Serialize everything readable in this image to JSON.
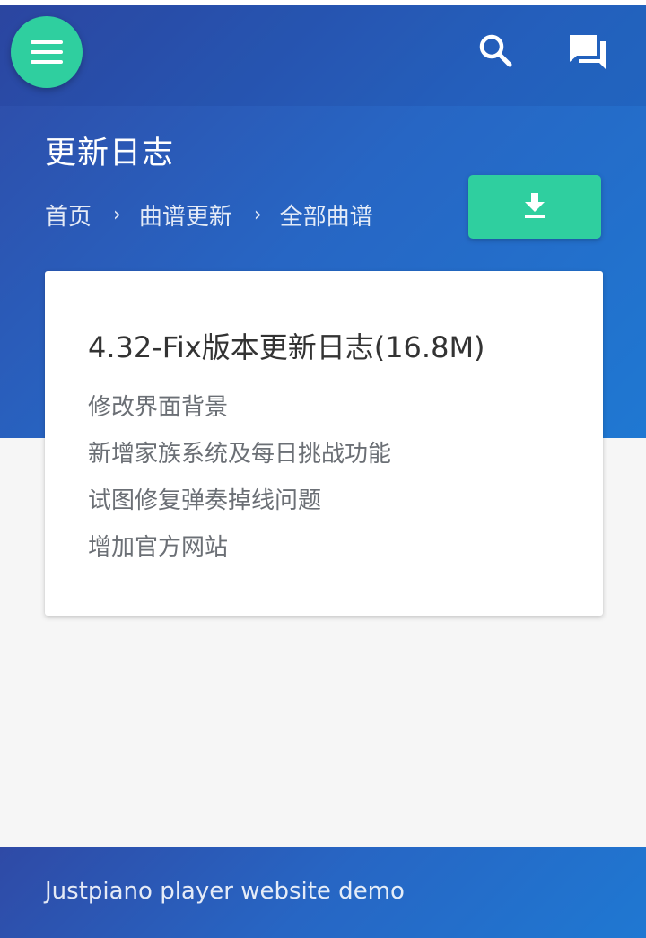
{
  "header": {
    "menu_icon": "hamburger-menu-icon",
    "search_icon": "search-icon",
    "chat_icon": "forum-chat-icon"
  },
  "page": {
    "title": "更新日志",
    "breadcrumb": [
      "首页",
      "曲谱更新",
      "全部曲谱"
    ],
    "breadcrumb_separator": "›",
    "download_icon": "download-icon"
  },
  "card": {
    "title": "4.32-Fix版本更新日志(16.8M)",
    "changes": [
      "修改界面背景",
      "新增家族系统及每日挑战功能",
      "试图修复弹奏掉线问题",
      "增加官方网站"
    ]
  },
  "footer": {
    "text": "Justpiano player website demo"
  },
  "colors": {
    "primary_gradient_start": "#2f4aa6",
    "primary_gradient_end": "#1f78d2",
    "accent": "#2fcf9f",
    "background": "#f6f6f6",
    "card_title": "#333333",
    "card_text": "#6b6f75"
  }
}
